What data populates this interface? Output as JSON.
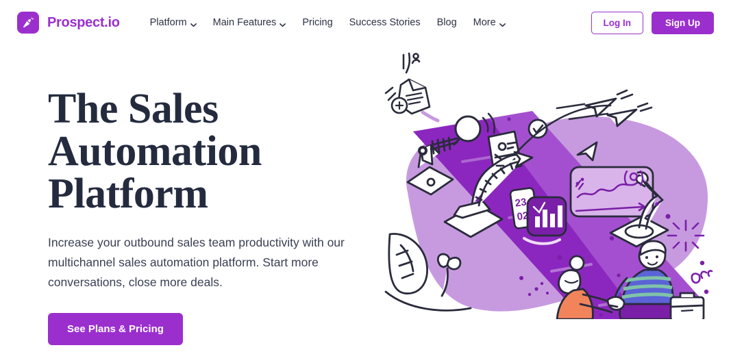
{
  "brand": {
    "name": "Prospect.io",
    "logo_icon": "carrot-icon",
    "color": "#9B2FCE"
  },
  "nav": {
    "items": [
      {
        "label": "Platform",
        "has_dropdown": true,
        "icon": "chevron-down-icon"
      },
      {
        "label": "Main Features",
        "has_dropdown": true,
        "icon": "chevron-down-icon"
      },
      {
        "label": "Pricing",
        "has_dropdown": false,
        "icon": ""
      },
      {
        "label": "Success Stories",
        "has_dropdown": false,
        "icon": ""
      },
      {
        "label": "Blog",
        "has_dropdown": false,
        "icon": ""
      },
      {
        "label": "More",
        "has_dropdown": true,
        "icon": "chevron-down-icon"
      }
    ]
  },
  "header_actions": {
    "login_label": "Log In",
    "signup_label": "Sign Up"
  },
  "hero": {
    "title_lines": [
      "The Sales",
      "Automation",
      "Platform"
    ],
    "title_text": "The Sales Automation Platform",
    "subtitle": "Increase your outbound sales team productivity with our multichannel sales automation platform. Start more conversations, close more deals.",
    "cta_label": "See Plans & Pricing",
    "illustration": {
      "name": "sales-automation-illustration",
      "description": "Hand-drawn purple illustration: robotic arms on a conveyor belt processing contact cards, paper planes flying off, and two people shaking hands.",
      "calendar_card": {
        "day": "23",
        "month": "02"
      },
      "colors": {
        "blob_light": "#C79AE0",
        "belt_dark": "#8B27BE",
        "belt_mid": "#A44FD0",
        "ink": "#2A2B3C",
        "accent": "#7A1FA8",
        "skin_orange": "#F2845C",
        "shirt_blue": "#5B63D6",
        "shirt_green": "#7FC3A8"
      }
    }
  }
}
